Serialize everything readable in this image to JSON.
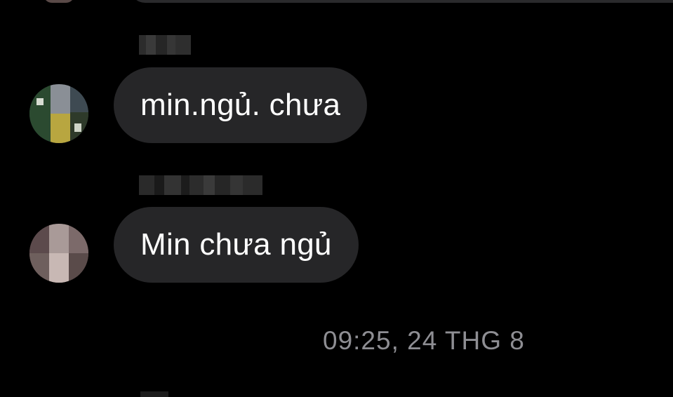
{
  "conversation": {
    "messages": [
      {
        "text": "min.ngủ. chưa"
      },
      {
        "text": "Min chưa ngủ"
      }
    ],
    "timestamp": "09:25, 24 THG 8"
  },
  "colors": {
    "background": "#000000",
    "bubble": "#262628",
    "message_text": "#ffffff",
    "timestamp_text": "#8e8e93"
  }
}
